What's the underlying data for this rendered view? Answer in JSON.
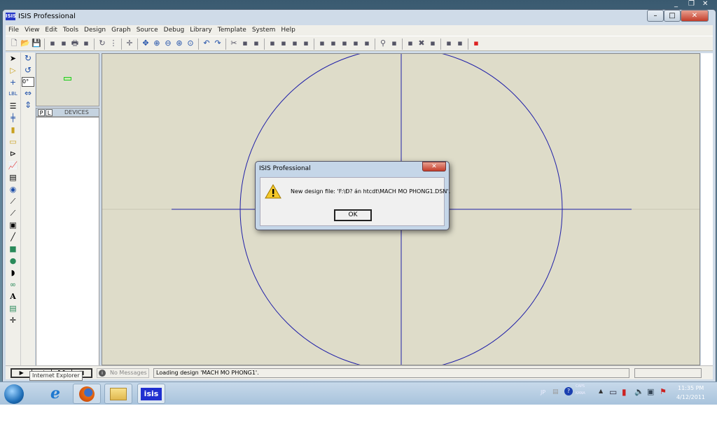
{
  "window": {
    "title": "ISIS Professional",
    "logo": "ISIS",
    "min": "–",
    "max": "□",
    "close": "✕"
  },
  "menu": [
    "File",
    "View",
    "Edit",
    "Tools",
    "Design",
    "Graph",
    "Source",
    "Debug",
    "Library",
    "Template",
    "System",
    "Help"
  ],
  "toolbar_icons": [
    "new-icon",
    "open-icon",
    "save-icon",
    "import-icon",
    "export-icon",
    "print-icon",
    "print-area-icon",
    "refresh-icon",
    "grid-icon",
    "origin-icon",
    "pan-icon",
    "zoom-in-icon",
    "zoom-out-icon",
    "zoom-all-icon",
    "zoom-area-icon",
    "undo-icon",
    "redo-icon",
    "cut-icon",
    "copy-icon",
    "paste-icon",
    "block-copy-icon",
    "block-move-icon",
    "block-rotate-icon",
    "block-delete-icon",
    "pick-device-icon",
    "make-device-icon",
    "package-icon",
    "decompose-icon",
    "wire-autorouter-icon",
    "search-icon",
    "property-assign-icon",
    "new-sheet-icon",
    "remove-sheet-icon",
    "exit-parent-icon",
    "bom-icon",
    "erc-icon",
    "netlist-ares-icon"
  ],
  "left_panel": {
    "rotation": "0°",
    "tab_p": "P",
    "tab_l": "L",
    "devices_label": "DEVICES"
  },
  "dialog": {
    "title": "ISIS Professional",
    "message": "New design file: 'F:\\Đ? án htcdt\\MACH MO PHONG1.DSN'.",
    "ok": "OK",
    "icon": "warning-icon"
  },
  "status": {
    "messages": "No Messages",
    "text": "Loading design 'MACH MO PHONG1'.",
    "tooltip": "Internet Explorer"
  },
  "taskbar": {
    "apps": [
      "Internet Explorer",
      "Firefox",
      "Windows Explorer",
      "ISIS"
    ],
    "isis_label": "isis",
    "lang": "JP",
    "ime_top": "CAPS",
    "ime_bottom": "KANA",
    "time": "11:35 PM",
    "date": "4/12/2011"
  },
  "colors": {
    "canvas": "#dedcc9",
    "drawing": "#1f1fa8",
    "axis": "#1f1fa8"
  }
}
